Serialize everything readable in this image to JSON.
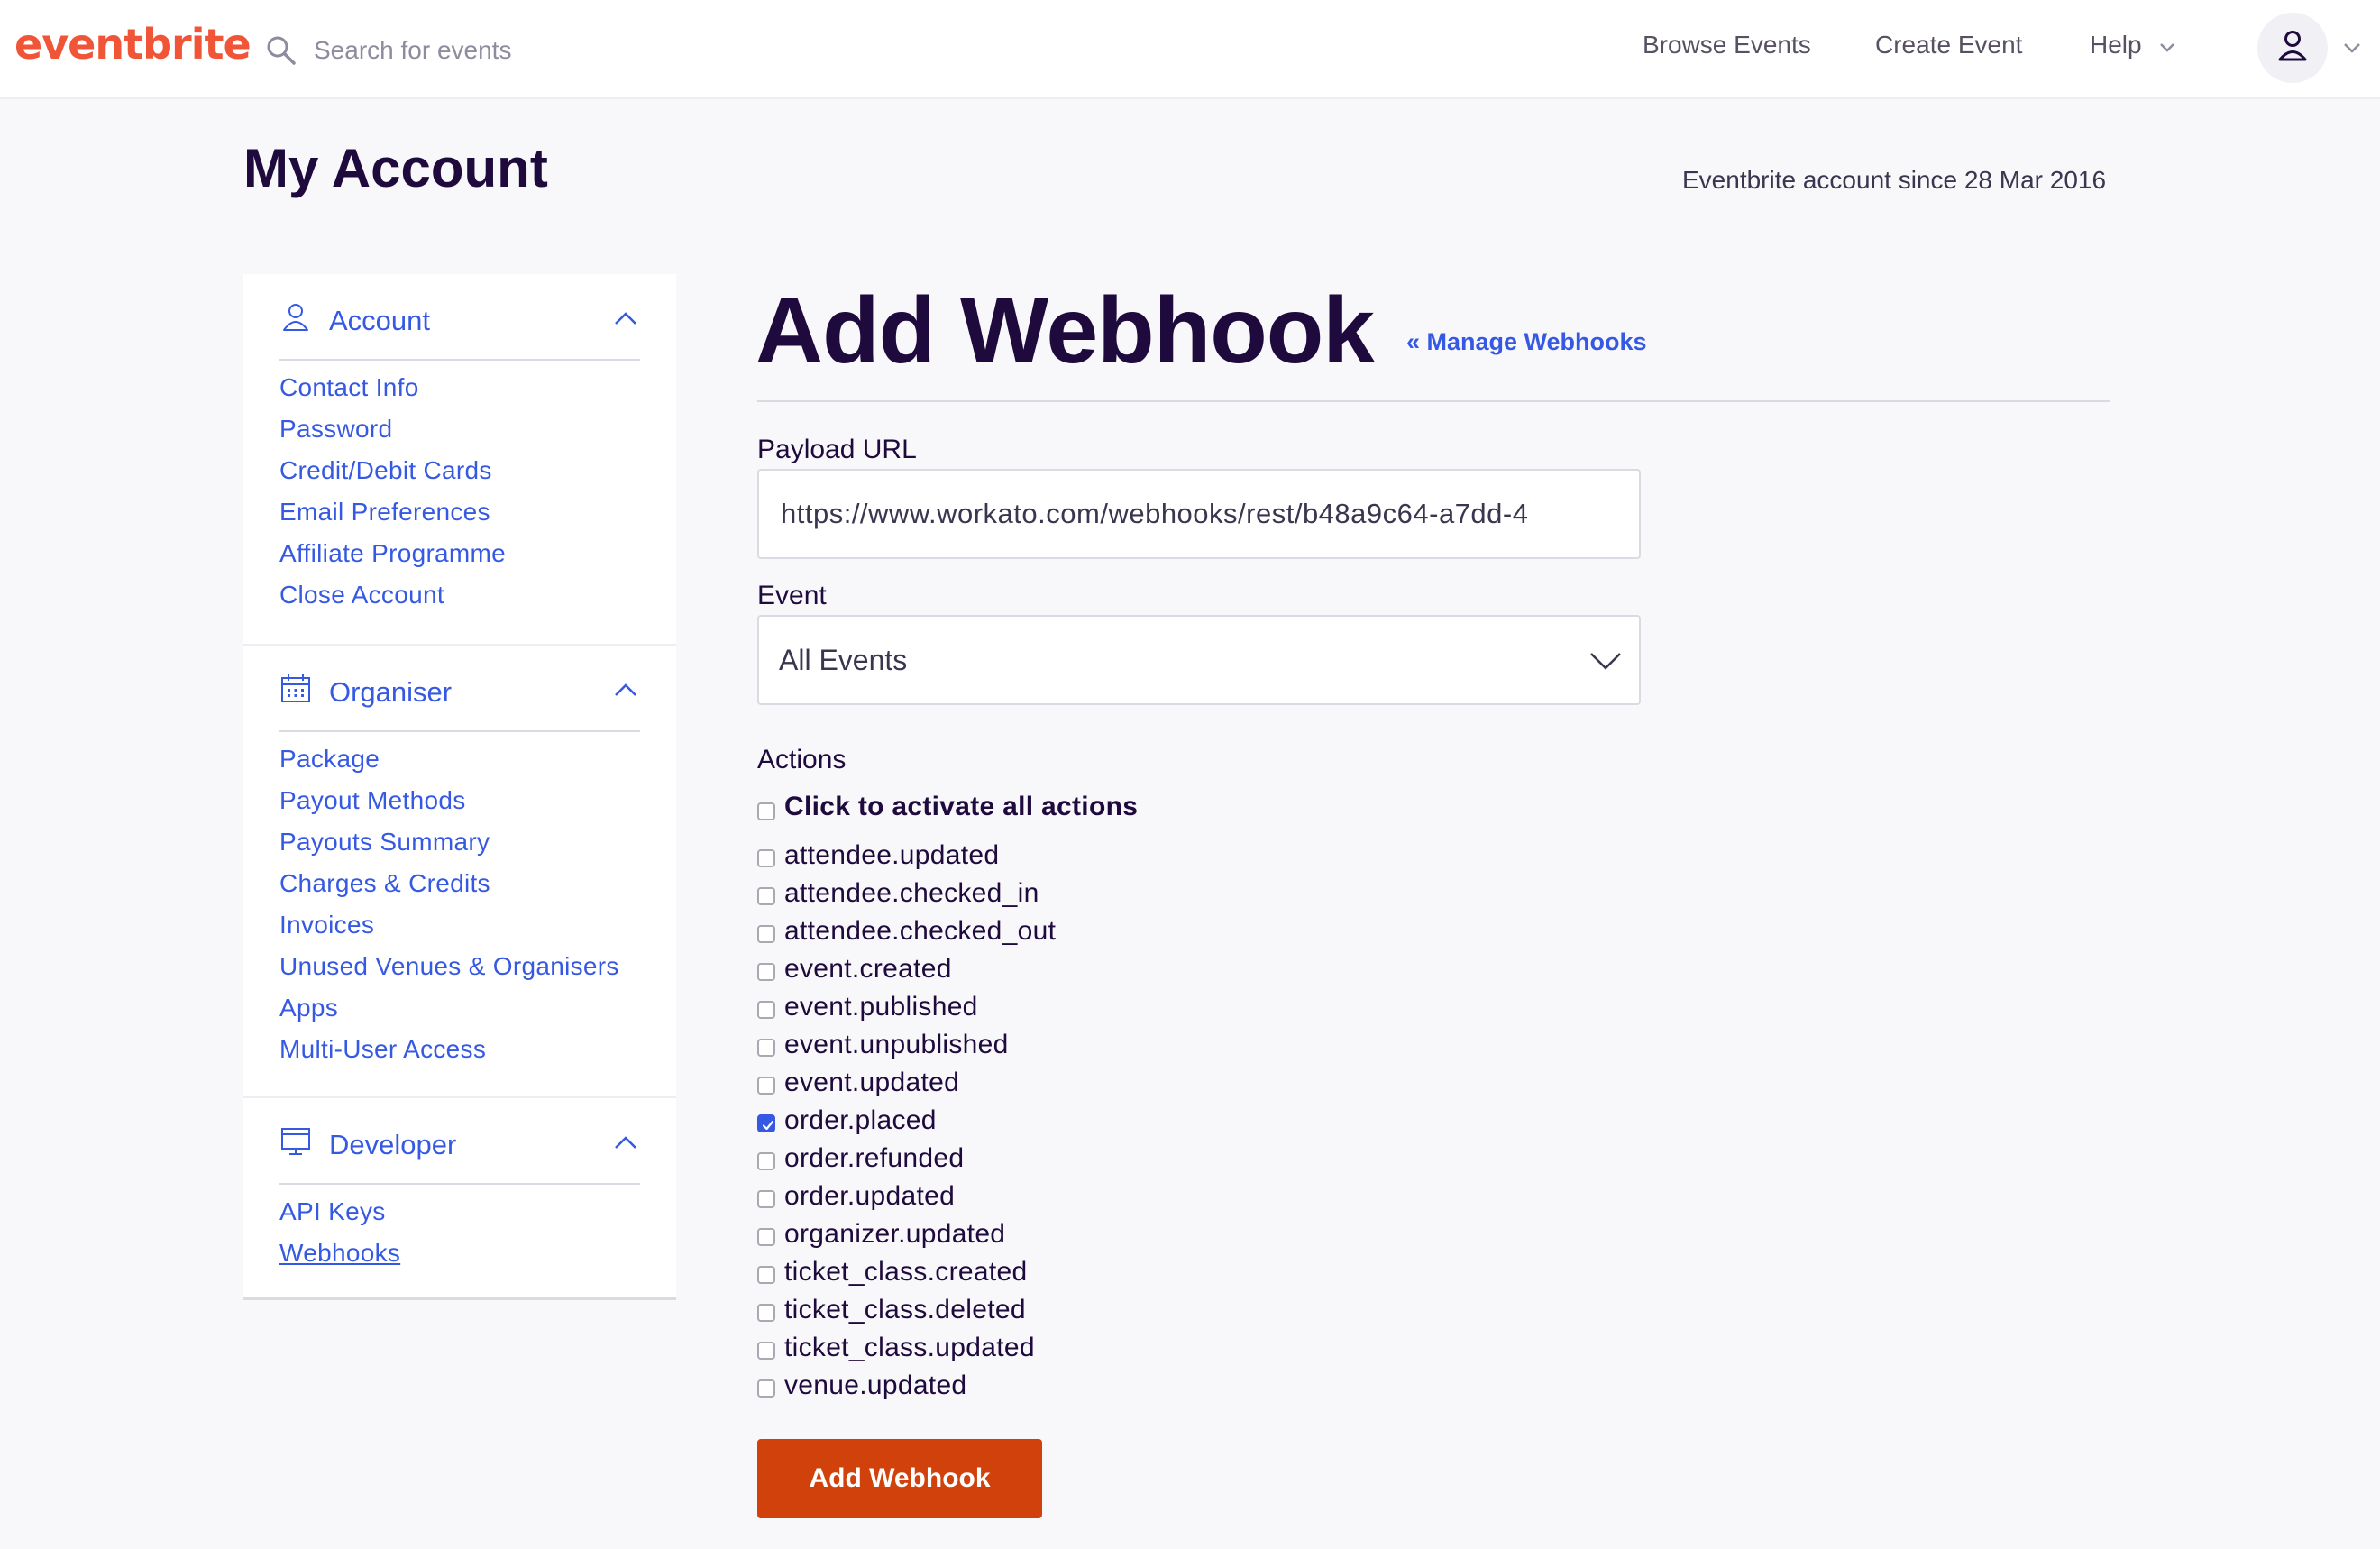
{
  "nav": {
    "logo": "eventbrite",
    "search_placeholder": "Search for events",
    "browse_events": "Browse Events",
    "create_event": "Create Event",
    "help": "Help"
  },
  "header": {
    "title": "My Account",
    "account_since": "Eventbrite account since 28 Mar 2016"
  },
  "sidebar": {
    "account": {
      "title": "Account",
      "items": [
        "Contact Info",
        "Password",
        "Credit/Debit Cards",
        "Email Preferences",
        "Affiliate Programme",
        "Close Account"
      ]
    },
    "organiser": {
      "title": "Organiser",
      "items": [
        "Package",
        "Payout Methods",
        "Payouts Summary",
        "Charges & Credits",
        "Invoices",
        "Unused Venues & Organisers",
        "Apps",
        "Multi-User Access"
      ]
    },
    "developer": {
      "title": "Developer",
      "items": [
        "API Keys",
        "Webhooks"
      ],
      "active_item": "Webhooks"
    }
  },
  "main": {
    "title": "Add Webhook",
    "manage_link": "« Manage Webhooks",
    "payload_label": "Payload URL",
    "payload_value": "https://www.workato.com/webhooks/rest/b48a9c64-a7dd-4",
    "event_label": "Event",
    "event_value": "All Events",
    "actions_label": "Actions",
    "activate_all": "Click to activate all actions",
    "actions": [
      {
        "label": "attendee.updated",
        "checked": false
      },
      {
        "label": "attendee.checked_in",
        "checked": false
      },
      {
        "label": "attendee.checked_out",
        "checked": false
      },
      {
        "label": "event.created",
        "checked": false
      },
      {
        "label": "event.published",
        "checked": false
      },
      {
        "label": "event.unpublished",
        "checked": false
      },
      {
        "label": "event.updated",
        "checked": false
      },
      {
        "label": "order.placed",
        "checked": true
      },
      {
        "label": "order.refunded",
        "checked": false
      },
      {
        "label": "order.updated",
        "checked": false
      },
      {
        "label": "organizer.updated",
        "checked": false
      },
      {
        "label": "ticket_class.created",
        "checked": false
      },
      {
        "label": "ticket_class.deleted",
        "checked": false
      },
      {
        "label": "ticket_class.updated",
        "checked": false
      },
      {
        "label": "venue.updated",
        "checked": false
      }
    ],
    "submit_label": "Add Webhook"
  },
  "colors": {
    "brand": "#f05537",
    "link": "#3659e3",
    "primary_button": "#d1410c",
    "heading": "#1e0a3c"
  }
}
